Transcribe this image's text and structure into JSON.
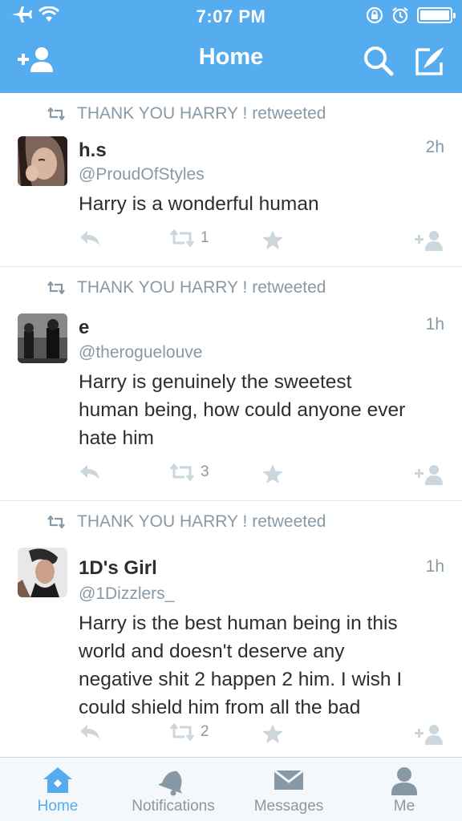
{
  "status_bar": {
    "time": "7:07 PM",
    "icons": [
      "airplane-icon",
      "wifi-icon",
      "orientation-lock-icon",
      "alarm-icon",
      "battery-icon"
    ]
  },
  "nav": {
    "title": "Home",
    "left_icon": "add-user-icon",
    "right_icons": [
      "search-icon",
      "compose-icon"
    ]
  },
  "tweets": [
    {
      "retweet_label": "THANK YOU HARRY ! retweeted",
      "name": "h.s",
      "handle": "@ProudOfStyles",
      "time": "2h",
      "lines": [
        "Harry is a wonderful human"
      ],
      "retweet_count": "1"
    },
    {
      "retweet_label": "THANK YOU HARRY ! retweeted",
      "name": "e",
      "handle": "@theroguelouve",
      "time": "1h",
      "lines": [
        "Harry is genuinely the sweetest",
        "human being, how could anyone ever",
        "hate him"
      ],
      "retweet_count": "3"
    },
    {
      "retweet_label": "THANK YOU HARRY ! retweeted",
      "name": "1D's Girl",
      "handle": "@1Dizzlers_",
      "time": "1h",
      "lines": [
        "Harry is the best human being in this",
        "world and doesn't deserve any",
        "negative shit 2 happen 2 him. I wish I",
        "could shield him from all the bad"
      ],
      "retweet_count": "2"
    }
  ],
  "tabs": [
    {
      "label": "Home",
      "icon": "home-icon",
      "active": true
    },
    {
      "label": "Notifications",
      "icon": "bell-icon",
      "active": false
    },
    {
      "label": "Messages",
      "icon": "envelope-icon",
      "active": false
    },
    {
      "label": "Me",
      "icon": "person-icon",
      "active": false
    }
  ],
  "colors": {
    "brand": "#55acee",
    "muted": "#8899a6",
    "text": "#292f33",
    "divider": "#e1e8ed"
  }
}
